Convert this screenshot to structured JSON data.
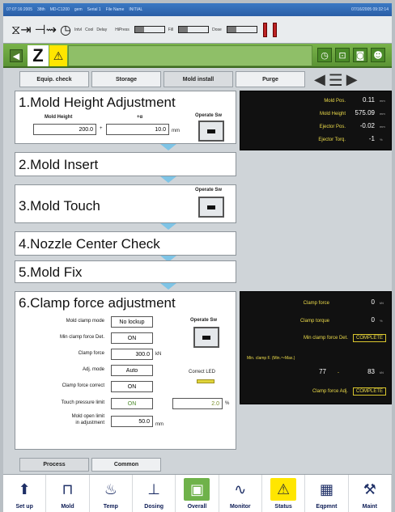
{
  "topbar": {
    "items": [
      "07:07:16:2005",
      "38th",
      "MD-C1200",
      "gem",
      "Serial 1",
      "File Name",
      "INITIAL"
    ],
    "right": "07/16/2005 09:32:14"
  },
  "iconrow": {
    "icons": [
      "press-ejector-icon",
      "injection-unit-icon",
      "clock-icon",
      "interval-icon",
      "cool-icon",
      "delay-icon"
    ],
    "small_labels": [
      "Intvl",
      "Cool",
      "Delay"
    ],
    "gauge_labels": [
      "HiPress",
      "Fill",
      "Dose"
    ]
  },
  "greenbar": {
    "logo": "Z",
    "warn_glyph": "⚠",
    "icons": [
      "timer-icon",
      "lock-icon",
      "camera-icon",
      "user-icon"
    ]
  },
  "tabs": {
    "items": [
      "Equip. check",
      "Storage",
      "Mold install",
      "Purge"
    ],
    "active": 2
  },
  "steps": {
    "s1_title": "1.Mold Height Adjustment",
    "s1_mold_height_label": "Mold Height",
    "s1_plus_alpha_label": "+α",
    "s1_mold_height": "200.0",
    "s1_plus": "+",
    "s1_alpha": "10.0",
    "s1_unit": "mm",
    "operate_sw": "Operate Sw",
    "s2_title": "2.Mold Insert",
    "s3_title": "3.Mold Touch",
    "s4_title": "4.Nozzle Center Check",
    "s5_title": "5.Mold Fix",
    "s6_title": "6.Clamp force adjustment",
    "correct_led": "Correct LED"
  },
  "mold_panel": {
    "rows": [
      {
        "label": "Mold Pos.",
        "value": "0.11",
        "unit": "mm"
      },
      {
        "label": "Mold Height",
        "value": "575.09",
        "unit": "mm"
      },
      {
        "label": "Ejector Pos.",
        "value": "-0.02",
        "unit": "mm"
      },
      {
        "label": "Ejector Torq.",
        "value": "-1",
        "unit": "%"
      }
    ]
  },
  "clamp_form": {
    "mode_label": "Mold clamp mode",
    "mode_value": "No lockup",
    "min_det_label": "Min clamp force Det.",
    "min_det_value": "ON",
    "force_label": "Clamp force",
    "force_value": "300.0",
    "force_unit": "kN",
    "adj_mode_label": "Adj. mode",
    "adj_mode_value": "Auto",
    "correct_label": "Clamp force correct",
    "correct_value": "ON",
    "touch_label": "Touch pressure limit",
    "touch_value": "ON",
    "touch_pct": "2.0",
    "touch_pct_unit": "%",
    "open_limit_label": "Mold open limit",
    "open_limit_label2": "in adjustment",
    "open_limit_value": "50.0",
    "open_limit_unit": "mm"
  },
  "clamp_panel": {
    "force_label": "Clamp force",
    "force_value": "0",
    "force_unit": "kN",
    "torque_label": "Clamp torque",
    "torque_value": "0",
    "torque_unit": "%",
    "min_det_label": "Min clamp force Det.",
    "min_det_status": "COMPLETE",
    "range_label": "Min. clamp F. (Min.〜Max.)",
    "range_min": "77",
    "range_dash": "-",
    "range_max": "83",
    "range_unit": "kN",
    "adj_label": "Clamp force Adj.",
    "adj_status": "COMPLETE"
  },
  "process_tabs": [
    "Process",
    "Common"
  ],
  "bottom_nav": [
    {
      "label": "Set up",
      "icon": "setup-icon",
      "glyph": "⬆"
    },
    {
      "label": "Mold",
      "icon": "mold-icon",
      "glyph": "⊓"
    },
    {
      "label": "Temp",
      "icon": "temp-icon",
      "glyph": "♨"
    },
    {
      "label": "Dosing",
      "icon": "dosing-icon",
      "glyph": "⊥"
    },
    {
      "label": "Overall",
      "icon": "overall-icon",
      "glyph": "▣"
    },
    {
      "label": "Monitor",
      "icon": "monitor-icon",
      "glyph": "∿"
    },
    {
      "label": "Status",
      "icon": "warning-icon",
      "glyph": "⚠"
    },
    {
      "label": "Eqpmnt",
      "icon": "equipment-icon",
      "glyph": "▦"
    },
    {
      "label": "Maint",
      "icon": "wrench-icon",
      "glyph": "⚒"
    }
  ]
}
